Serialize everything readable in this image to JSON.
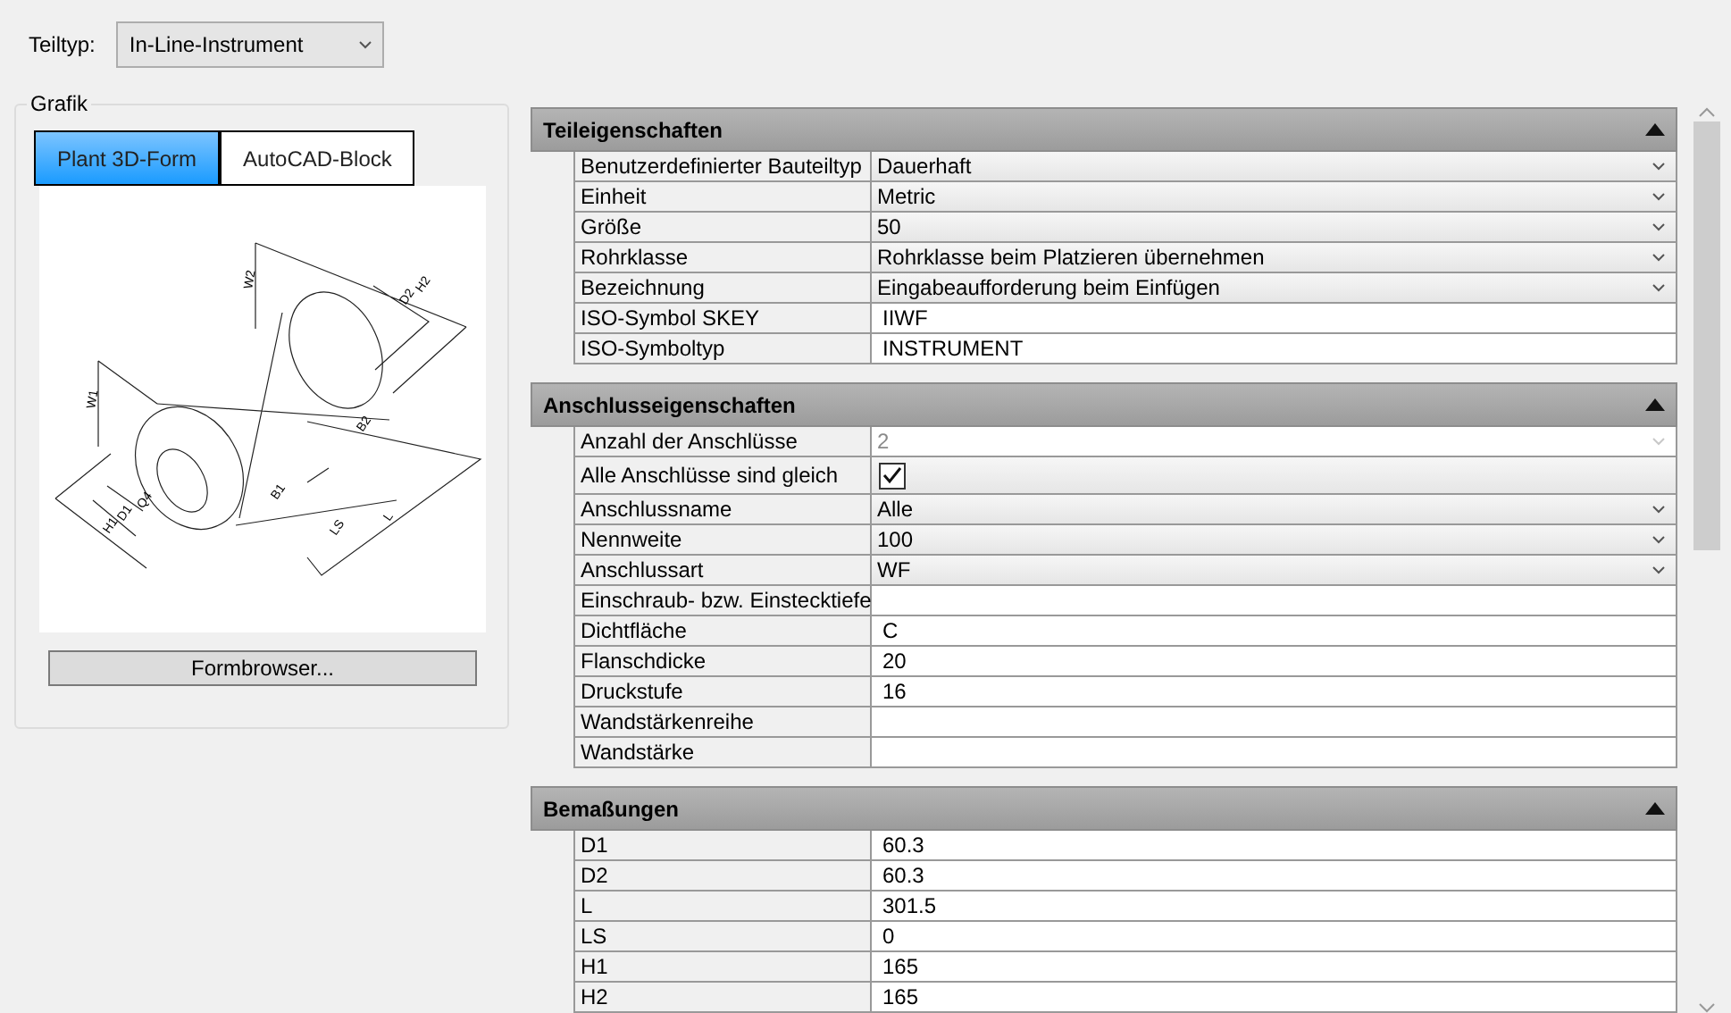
{
  "part_type": {
    "label": "Teiltyp:",
    "value": "In-Line-Instrument"
  },
  "graphic": {
    "title": "Grafik",
    "tabs": [
      {
        "label": "Plant 3D-Form",
        "selected": true
      },
      {
        "label": "AutoCAD-Block",
        "selected": false
      }
    ],
    "dimension_labels": [
      "H2",
      "D2",
      "W2",
      "B2",
      "W1",
      "Q4",
      "D1",
      "H1",
      "B1",
      "LS",
      "L"
    ],
    "button": "Formbrowser..."
  },
  "sections": [
    {
      "title": "Teileigenschaften",
      "expanded": true,
      "rows": [
        {
          "label": "Benutzerdefinierter Bauteiltyp",
          "value": "Dauerhaft",
          "kind": "dropdown",
          "disabled": false
        },
        {
          "label": "Einheit",
          "value": "Metric",
          "kind": "dropdown",
          "disabled": false
        },
        {
          "label": "Größe",
          "value": "50",
          "kind": "dropdown",
          "disabled": false
        },
        {
          "label": "Rohrklasse",
          "value": "Rohrklasse beim Platzieren übernehmen",
          "kind": "dropdown",
          "disabled": false
        },
        {
          "label": "Bezeichnung",
          "value": "Eingabeaufforderung beim Einfügen",
          "kind": "dropdown",
          "disabled": false
        },
        {
          "label": "ISO-Symbol SKEY",
          "value": "IIWF",
          "kind": "text"
        },
        {
          "label": "ISO-Symboltyp",
          "value": "INSTRUMENT",
          "kind": "text"
        }
      ]
    },
    {
      "title": "Anschlusseigenschaften",
      "expanded": true,
      "rows": [
        {
          "label": "Anzahl der Anschlüsse",
          "value": "2",
          "kind": "dropdown",
          "disabled": true
        },
        {
          "label": "Alle Anschlüsse sind gleich",
          "kind": "checkbox",
          "checked": true
        },
        {
          "label": "Anschlussname",
          "value": "Alle",
          "kind": "dropdown",
          "disabled": false
        },
        {
          "label": "Nennweite",
          "value": "100",
          "kind": "dropdown",
          "disabled": false
        },
        {
          "label": "Anschlussart",
          "value": "WF",
          "kind": "dropdown",
          "disabled": false
        },
        {
          "label": "Einschraub- bzw. Einstecktiefe",
          "kind": "text"
        },
        {
          "label": "Dichtfläche",
          "value": "C",
          "kind": "text"
        },
        {
          "label": "Flanschdicke",
          "value": "20",
          "kind": "text"
        },
        {
          "label": "Druckstufe",
          "value": "16",
          "kind": "text"
        },
        {
          "label": "Wandstärkenreihe",
          "kind": "text"
        },
        {
          "label": "Wandstärke",
          "kind": "text"
        }
      ]
    },
    {
      "title": "Bemaßungen",
      "expanded": true,
      "rows": [
        {
          "label": "D1",
          "value": "60.3",
          "kind": "text"
        },
        {
          "label": "D2",
          "value": "60.3",
          "kind": "text"
        },
        {
          "label": "L",
          "value": "301.5",
          "kind": "text"
        },
        {
          "label": "LS",
          "value": "0",
          "kind": "text"
        },
        {
          "label": "H1",
          "value": "165",
          "kind": "text"
        },
        {
          "label": "H2",
          "value": "165",
          "kind": "text"
        }
      ]
    }
  ]
}
